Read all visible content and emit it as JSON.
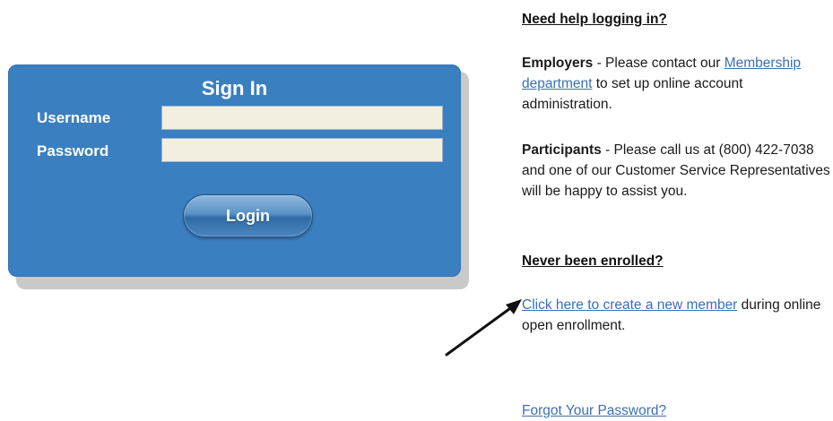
{
  "login": {
    "title": "Sign In",
    "username_label": "Username",
    "password_label": "Password",
    "username_value": "",
    "password_value": "",
    "button_label": "Login",
    "panel_color": "#3a7fc0"
  },
  "help": {
    "heading": "Need help logging in?",
    "employers_label": "Employers",
    "employers_prefix": " - Please contact our ",
    "employers_link": "Membership department",
    "employers_suffix": " to set up online account administration.",
    "participants_label": "Participants",
    "participants_text": " - Please call us at (800) 422-7038 and one of our Customer Service Representatives will be happy to assist you."
  },
  "enroll": {
    "heading": "Never been enrolled?",
    "create_link": "Click here to create a new member",
    "create_suffix": " during online open enrollment."
  },
  "forgot": {
    "link": "Forgot Your Password?"
  },
  "icons": {
    "arrow": "arrow-pointer-icon"
  },
  "colors": {
    "link": "#3d6fb0",
    "panel": "#3a7fc0",
    "input_bg": "#f2efe0"
  }
}
